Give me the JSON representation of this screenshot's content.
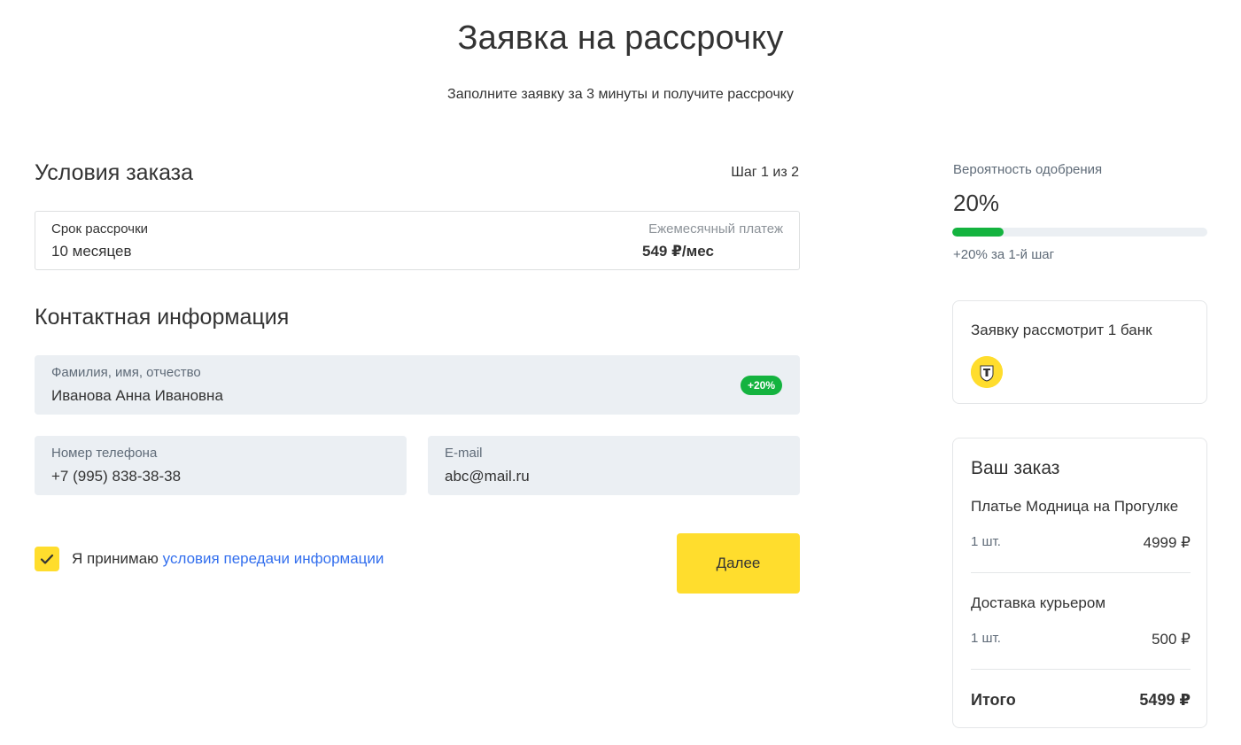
{
  "header": {
    "title": "Заявка на рассрочку",
    "subtitle": "Заполните заявку за 3 минуты и получите рассрочку"
  },
  "order_conditions": {
    "title": "Условия заказа",
    "step": "Шаг 1 из 2",
    "term_label": "Срок рассрочки",
    "term_value": "10 месяцев",
    "payment_label": "Ежемесячный платеж",
    "payment_value": "549 ₽/мес"
  },
  "contact": {
    "title": "Контактная информация",
    "name_label": "Фамилия, имя, отчество",
    "name_value": "Иванова Анна Ивановна",
    "name_badge": "+20%",
    "phone_label": "Номер телефона",
    "phone_value": "+7 (995) 838-38-38",
    "email_label": "E-mail",
    "email_value": "abc@mail.ru"
  },
  "agreement": {
    "checked": true,
    "text": "Я принимаю ",
    "link": "условия передачи информации"
  },
  "next_button": "Далее",
  "approval": {
    "label": "Вероятность одобрения",
    "value": "20%",
    "fraction": 0.2,
    "hint": "+20% за 1-й шаг"
  },
  "bank_card": {
    "title": "Заявку рассмотрит 1 банк",
    "logo_icon": "bank-emblem-icon"
  },
  "order": {
    "title": "Ваш заказ",
    "items": [
      {
        "name": "Платье Модница на Прогулке",
        "qty": "1 шт.",
        "price": "4999 ₽"
      },
      {
        "name": "Доставка курьером",
        "qty": "1 шт.",
        "price": "500 ₽"
      }
    ],
    "total_label": "Итого",
    "total_value": "5499 ₽"
  },
  "colors": {
    "accent_yellow": "#ffdd2d",
    "success_green": "#14b33f",
    "link_blue": "#336fee",
    "field_bg": "#ebeff3"
  }
}
